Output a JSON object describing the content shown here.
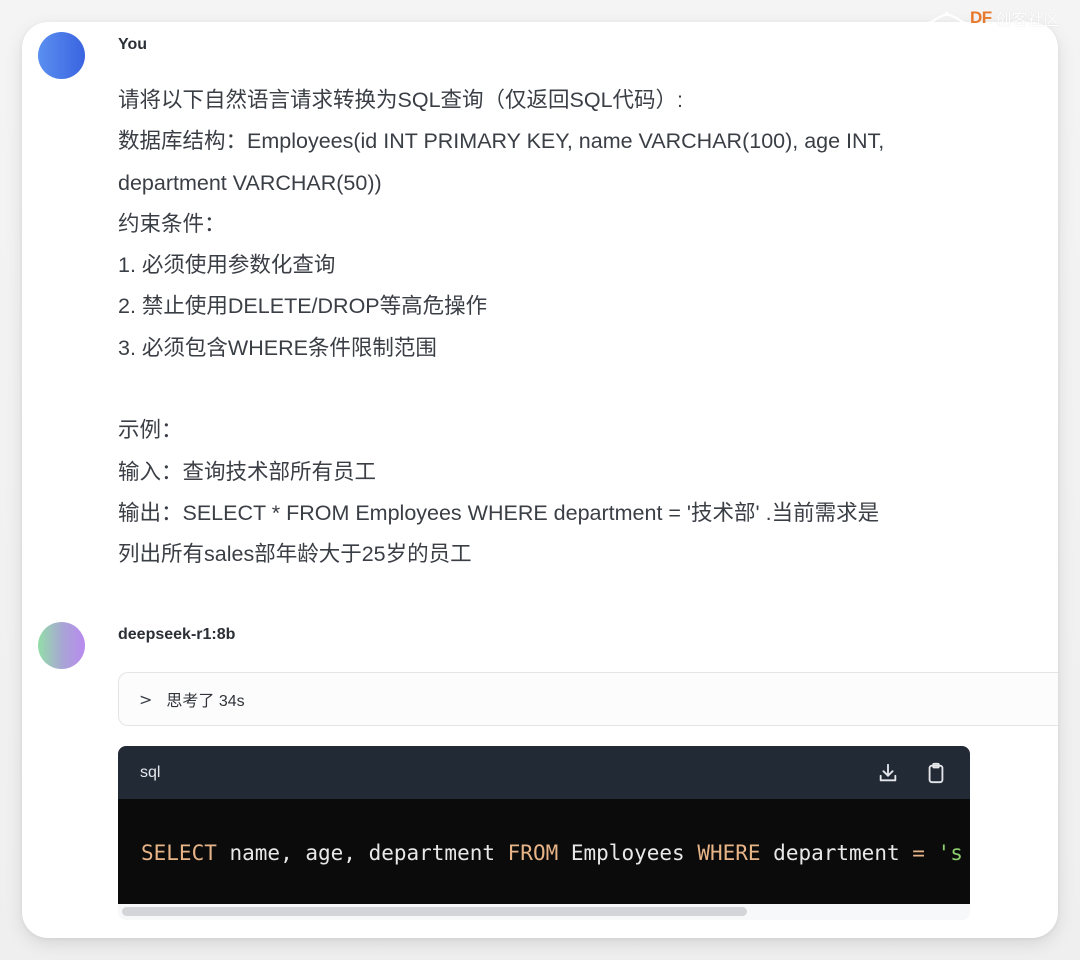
{
  "watermark": {
    "brand": "DF",
    "name": "创客社区",
    "brand_color": "#e8782c"
  },
  "user_message": {
    "sender": "You",
    "avatar_color": "#4a78e8",
    "lines": [
      "请将以下自然语言请求转换为SQL查询（仅返回SQL代码）:",
      "数据库结构：Employees(id INT PRIMARY KEY, name VARCHAR(100), age INT,",
      "department VARCHAR(50))",
      "约束条件：",
      "1. 必须使用参数化查询",
      "2. 禁止使用DELETE/DROP等高危操作",
      "3. 必须包含WHERE条件限制范围",
      "",
      "示例：",
      "输入：查询技术部所有员工",
      "输出：SELECT * FROM Employees WHERE department = '技术部' .当前需求是",
      "列出所有sales部年龄大于25岁的员工"
    ]
  },
  "assistant_message": {
    "sender": "deepseek-r1:8b",
    "thinking": {
      "icon": "chevron-right-icon",
      "label": "思考了 34s"
    },
    "code_block": {
      "language": "sql",
      "actions": [
        {
          "name": "download",
          "icon": "download-icon"
        },
        {
          "name": "copy",
          "icon": "clipboard-icon"
        }
      ],
      "tokens": [
        {
          "text": "SELECT",
          "type": "kw"
        },
        {
          "text": " name, age, department ",
          "type": "plain"
        },
        {
          "text": "FROM",
          "type": "kw"
        },
        {
          "text": " Employees ",
          "type": "plain"
        },
        {
          "text": "WHERE",
          "type": "kw"
        },
        {
          "text": " department ",
          "type": "plain"
        },
        {
          "text": "=",
          "type": "op"
        },
        {
          "text": " 's",
          "type": "str"
        }
      ],
      "scroll_fraction_visible": 0.74
    }
  }
}
